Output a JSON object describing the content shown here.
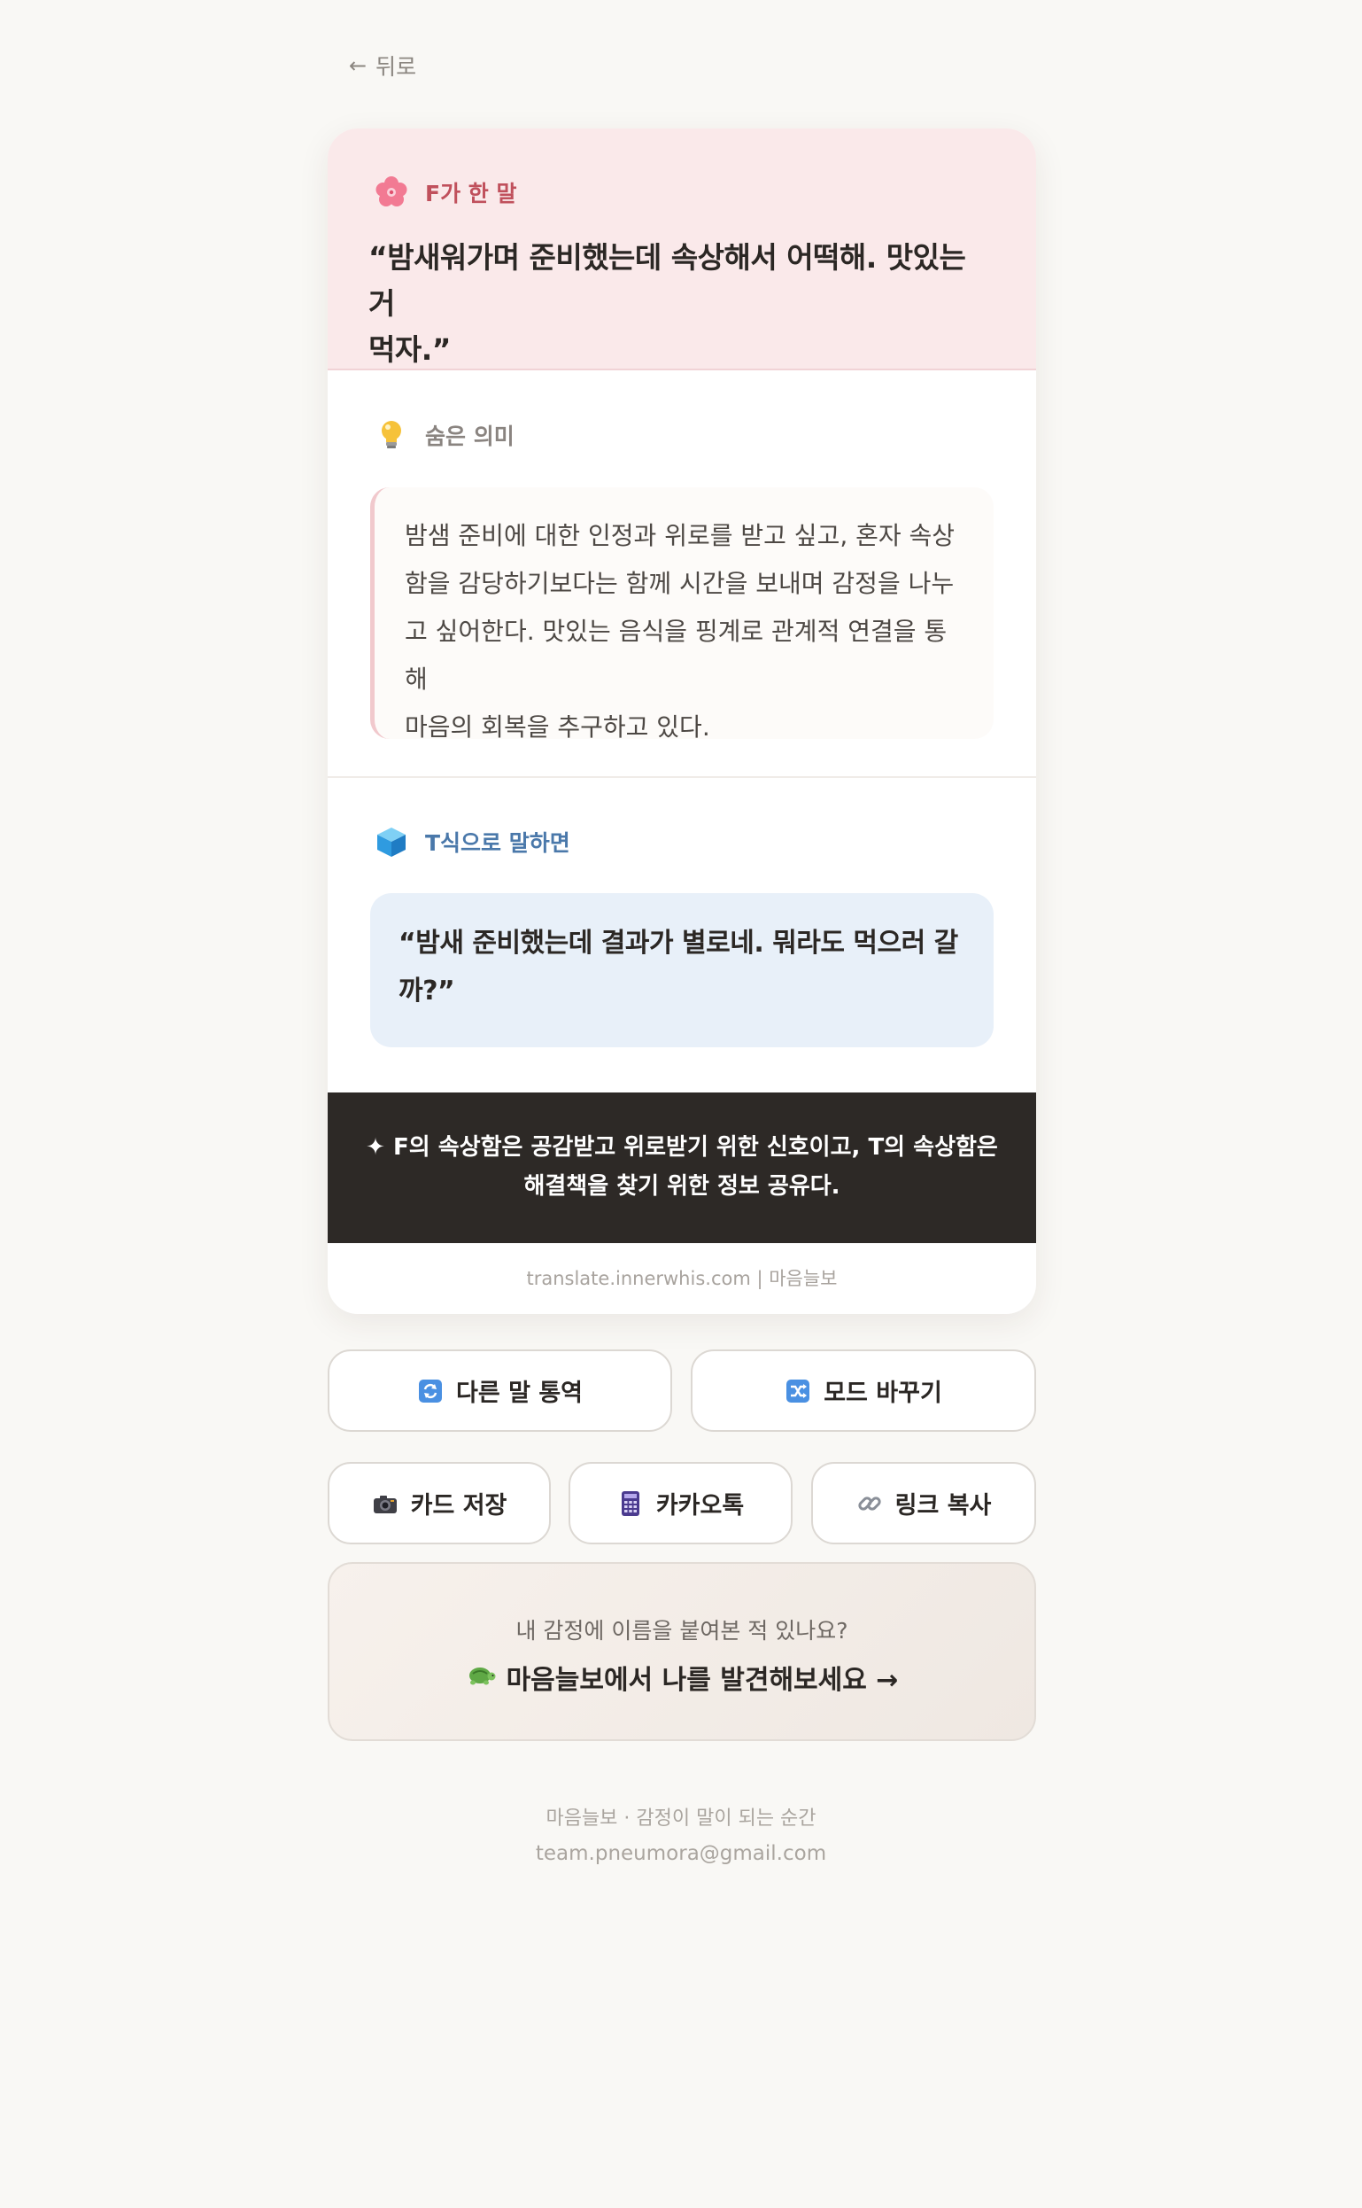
{
  "nav": {
    "back_label": "뒤로"
  },
  "card": {
    "f_section": {
      "heading": "F가 한 말",
      "quote_line1": "“밤새워가며 준비했는데 속상해서 어떡해. 맛있는 거",
      "quote_line2": "먹자.”"
    },
    "hidden_meaning": {
      "heading": "숨은 의미",
      "lines": [
        "밤샘 준비에 대한 인정과 위로를 받고 싶고, 혼자 속상",
        "함을 감당하기보다는 함께 시간을 보내며 감정을 나누",
        "고 싶어한다. 맛있는 음식을 핑계로 관계적 연결을 통해",
        "마음의 회복을 추구하고 있다."
      ]
    },
    "t_section": {
      "heading": "T식으로 말하면",
      "line1": "“밤새 준비했는데 결과가 별로네. 뭐라도 먹으러 갈",
      "line2": "까?”"
    },
    "summary": {
      "line1": "✦ F의 속상함은 공감받고 위로받기 위한 신호이고, T의 속상함은",
      "line2": "해결책을 찾기 위한 정보 공유다."
    },
    "source": "translate.innerwhis.com | 마음늘보"
  },
  "actions": {
    "translate_other": "다른 말 통역",
    "switch_mode": "모드 바꾸기",
    "save_card": "카드 저장",
    "kakao": "카카오톡",
    "copy_link": "링크 복사"
  },
  "cta": {
    "question": "내 감정에 이름을 붙여본 적 있나요?",
    "link_text": "마음늘보에서 나를 발견해보세요 →"
  },
  "footer": {
    "tagline": "마음늘보 · 감정이 말이 되는 순간",
    "email": "team.pneumora@gmail.com"
  },
  "icons": {
    "back": "arrow-left-icon",
    "f_section": "cherry-blossom-icon",
    "hidden_meaning": "light-bulb-icon",
    "t_section": "ice-cube-icon",
    "translate_other": "refresh-icon",
    "switch_mode": "shuffle-icon",
    "save_card": "camera-icon",
    "kakao": "phone-icon",
    "copy_link": "link-icon",
    "cta": "turtle-icon"
  },
  "colors": {
    "background": "#f9f8f5",
    "f_accent": "#c0505c",
    "f_bg": "#fae9ea",
    "t_accent": "#4a78aa",
    "t_bg": "#e8f0f9",
    "summary_bg": "#2d2926"
  }
}
